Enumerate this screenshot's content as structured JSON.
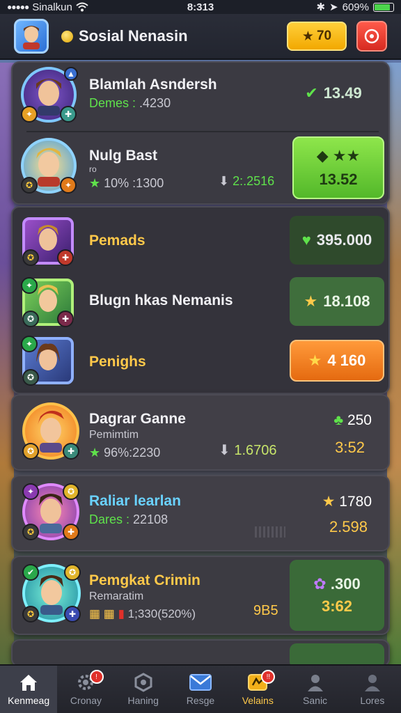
{
  "status_bar": {
    "carrier": "Sinalkun",
    "time": "8:313",
    "battery": "609%",
    "battery_level": 0.85
  },
  "header": {
    "title": "Sosial Nenasin",
    "stars": "70",
    "colors": {
      "accent_gold": "#ffcf3a",
      "accent_red": "#e0302a"
    }
  },
  "friends": [
    {
      "name": "Blamlah Asndersh",
      "detail_label": "Demes :",
      "detail_value": ".4230",
      "score": "13.49",
      "score_icon": "check-icon"
    },
    {
      "name": "Nulg Bast",
      "tag": "ro",
      "detail_value": "10% :1300",
      "mid_value": "2:.2516",
      "box_value": "13.52"
    },
    {
      "name": "Pemads",
      "box_value": "395.000"
    },
    {
      "name": "Blugn hkas Nemanis",
      "box_value": "18.108"
    },
    {
      "name": "Penighs",
      "box_value": "4 160"
    },
    {
      "name": "Dagrar Ganne",
      "subtitle": "Pemimtim",
      "detail_value": "96%:2230",
      "mid_value": "1.6706",
      "score_top": "250",
      "score_bottom": "3:52"
    },
    {
      "name": "Raliar learlan",
      "detail_label": "Dares :",
      "detail_value": "22108",
      "score_top": "1780",
      "score_bottom": "2.598"
    },
    {
      "name": "Pemgkat Crimin",
      "subtitle": "Remaratim",
      "detail_value": "1;330(520%)",
      "extra": "9B5",
      "box_top": ".300",
      "box_bottom": "3:62"
    }
  ],
  "tabbar": [
    {
      "label": "Kenmeag",
      "icon": "home-icon",
      "active": true
    },
    {
      "label": "Cronay",
      "icon": "gear-icon"
    },
    {
      "label": "Haning",
      "icon": "hex-icon"
    },
    {
      "label": "Resge",
      "icon": "mail-icon"
    },
    {
      "label": "Velains",
      "icon": "trophy-icon"
    },
    {
      "label": "Sanic",
      "icon": "person-icon"
    },
    {
      "label": "Lores",
      "icon": "person-icon"
    }
  ],
  "notifications": {
    "cronay_badge": "!",
    "velains_badge": "!!"
  }
}
